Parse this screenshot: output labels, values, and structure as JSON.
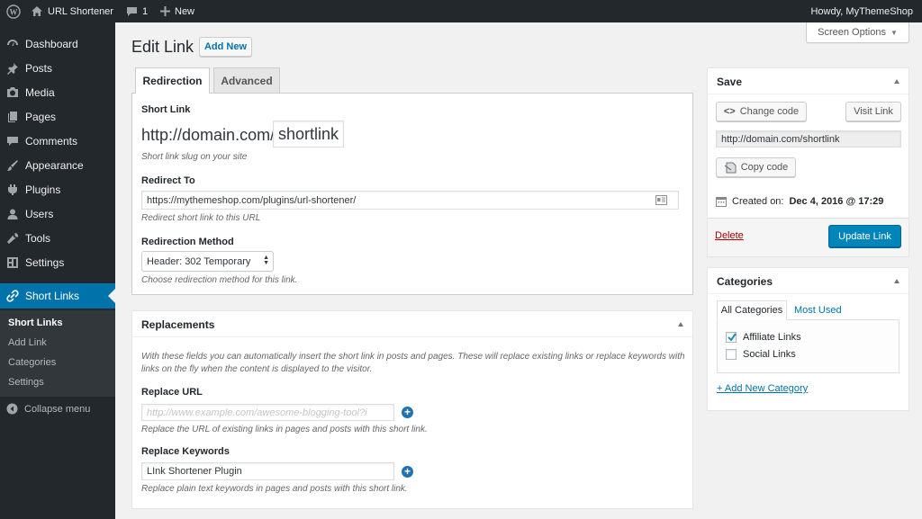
{
  "admin_bar": {
    "site_name": "URL Shortener",
    "comments_count": "1",
    "new_label": "New",
    "howdy": "Howdy, MyThemeShop"
  },
  "sidebar": {
    "items": [
      {
        "label": "Dashboard",
        "icon": "dashboard-icon"
      },
      {
        "label": "Posts",
        "icon": "pin-icon"
      },
      {
        "label": "Media",
        "icon": "media-icon"
      },
      {
        "label": "Pages",
        "icon": "pages-icon"
      },
      {
        "label": "Comments",
        "icon": "comment-icon"
      },
      {
        "label": "Appearance",
        "icon": "brush-icon"
      },
      {
        "label": "Plugins",
        "icon": "plugin-icon"
      },
      {
        "label": "Users",
        "icon": "user-icon"
      },
      {
        "label": "Tools",
        "icon": "wrench-icon"
      },
      {
        "label": "Settings",
        "icon": "settings-icon"
      }
    ],
    "active": {
      "label": "Short Links",
      "icon": "link-icon"
    },
    "submenu": [
      "Short Links",
      "Add Link",
      "Categories",
      "Settings"
    ],
    "collapse": "Collapse menu"
  },
  "header": {
    "title": "Edit Link",
    "add_new": "Add New",
    "screen_options": "Screen Options"
  },
  "tabs": [
    "Redirection",
    "Advanced"
  ],
  "redirection": {
    "short_link_label": "Short Link",
    "domain_prefix": "http://domain.com/",
    "slug": "shortlink",
    "short_link_desc": "Short link slug on your site",
    "redirect_to_label": "Redirect To",
    "redirect_to_value": "https://mythemeshop.com/plugins/url-shortener/",
    "redirect_to_desc": "Redirect short link to this URL",
    "method_label": "Redirection Method",
    "method_value": "Header: 302 Temporary",
    "method_desc": "Choose redirection method for this link."
  },
  "replacements": {
    "title": "Replacements",
    "intro": "With these fields you can automatically insert the short link in posts and pages. These will replace existing links or replace keywords with links on the fly when the content is displayed to the visitor.",
    "url_label": "Replace URL",
    "url_placeholder": "http://www.example.com/awesome-blogging-tool?i",
    "url_desc": "Replace the URL of existing links in pages and posts with this short link.",
    "keywords_label": "Replace Keywords",
    "keywords_value": "LInk Shortener Plugin",
    "keywords_desc": "Replace plain text keywords in pages and posts with this short link."
  },
  "save": {
    "title": "Save",
    "change_code": "Change code",
    "visit_link": "Visit Link",
    "url": "http://domain.com/shortlink",
    "copy_code": "Copy code",
    "created_label": "Created on:",
    "created_value": "Dec 4, 2016 @ 17:29",
    "delete": "Delete",
    "update": "Update Link"
  },
  "categories": {
    "title": "Categories",
    "tab_all": "All Categories",
    "tab_most_used": "Most Used",
    "items": [
      {
        "label": "Affiliate Links",
        "checked": true
      },
      {
        "label": "Social Links",
        "checked": false
      }
    ],
    "add_new": "+ Add New Category"
  },
  "colors": {
    "accent": "#0073aa",
    "sidebar_bg": "#23282d",
    "delete": "#a00"
  }
}
